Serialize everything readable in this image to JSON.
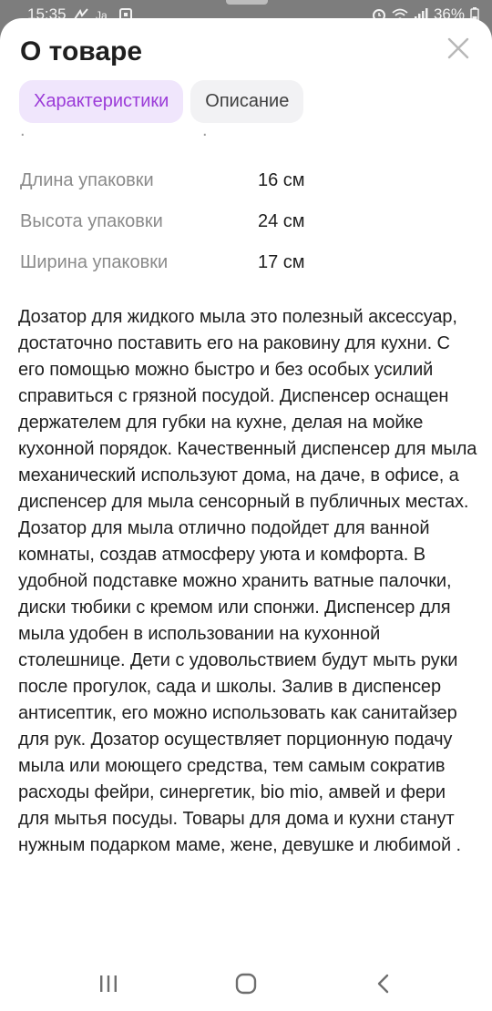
{
  "status_bar": {
    "time": "15:35",
    "battery": "36%"
  },
  "icons": {
    "close": "close-icon",
    "recents": "recents-icon",
    "home": "home-icon",
    "back": "back-icon"
  },
  "sheet": {
    "title": "О товаре",
    "tabs": [
      {
        "label": "Характеристики",
        "active": true
      },
      {
        "label": "Описание",
        "active": false
      }
    ]
  },
  "specs": [
    {
      "label": "Длина упаковки",
      "value": "16 см"
    },
    {
      "label": "Высота упаковки",
      "value": "24 см"
    },
    {
      "label": "Ширина упаковки",
      "value": "17 см"
    }
  ],
  "description": "Дозатор для жидкого мыла это полезный аксессуар, достаточно поставить его на раковину для кухни. С его помощью можно быстро и без особых усилий справиться с грязной посудой. Диспенсер оснащен держателем для губки на кухне, делая на мойке кухонной порядок. Качественный диспенсер для мыла механический используют дома, на даче, в офисе, а диспенсер для мыла сенсорный в публичных местах. Дозатор для мыла отлично подойдет для ванной комнаты, создав атмосферу уюта и комфорта. В удобной подставке можно хранить ватные палочки, диски тюбики с кремом или спонжи. Диспенсер для мыла удобен в использовании на кухонной столешнице. Дети с удовольствием будут мыть руки после прогулок, сада и школы. Залив в диспенсер антисептик, его можно использовать как санитайзер для рук. Дозатор осуществляет порционную подачу мыла или моющего средства, тем самым сократив расходы фейри, синергетик, bio mio, амвей и фери для мытья посуды. Товары для дома и кухни станут нужным подарком маме, жене, девушке и любимой .",
  "colors": {
    "accent": "#9b3bd8",
    "active_tab_bg": "#f0e6fc",
    "inactive_tab_bg": "#f2f2f4",
    "label_gray": "#8a8a8a",
    "text": "#1f1f1f"
  }
}
